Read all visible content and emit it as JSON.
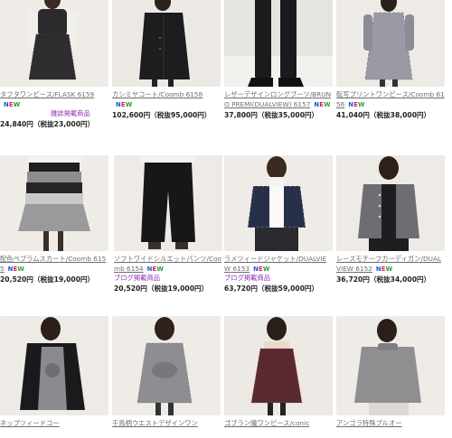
{
  "new_badge": [
    "N",
    "E",
    "W"
  ],
  "products": [
    {
      "name": "タフタワンピース/FLASK 6159",
      "new": true,
      "tag": "雑誌掲載商品",
      "price": "24,840円（税抜23,000円）"
    },
    {
      "name": "カシミヤコート/Coomb 6158",
      "new": true,
      "tag": "",
      "price": "102,600円（税抜95,000円）"
    },
    {
      "name": "レザーデザインロングブーツ/BRUNO PREMI(DUALVIEW) 6157",
      "new": true,
      "tag": "",
      "price": "37,800円（税抜35,000円）"
    },
    {
      "name": "転写プリントワンピース/Coomb 6156",
      "new": true,
      "tag": "",
      "price": "41,040円（税抜38,000円）"
    },
    {
      "name": "配色ペプラムスカート/Coomb 6155",
      "new": true,
      "tag": "",
      "price": "20,520円（税抜19,000円）"
    },
    {
      "name": "ソフトワイドシルエットパンツ/Coomb 6154",
      "new": true,
      "tag": "ブログ掲載商品",
      "price": "20,520円（税抜19,000円）"
    },
    {
      "name": "ラメツィードジャケット/DUALVIEW 6153",
      "new": true,
      "tag": "ブログ掲載商品",
      "price": "63,720円（税抜59,000円）"
    },
    {
      "name": "レースモチーフカーディガン/DUALVIEW 6152",
      "new": true,
      "tag": "",
      "price": "36,720円（税抜34,000円）"
    },
    {
      "name": "ネップツィードコー",
      "new": false,
      "tag": "",
      "price": ""
    },
    {
      "name": "千鳥柄ウエストデザインワン",
      "new": false,
      "tag": "",
      "price": ""
    },
    {
      "name": "ゴブラン織ワンピース/conic",
      "new": false,
      "tag": "",
      "price": ""
    },
    {
      "name": "アンゴラ特殊プルオー",
      "new": false,
      "tag": "",
      "price": ""
    }
  ]
}
